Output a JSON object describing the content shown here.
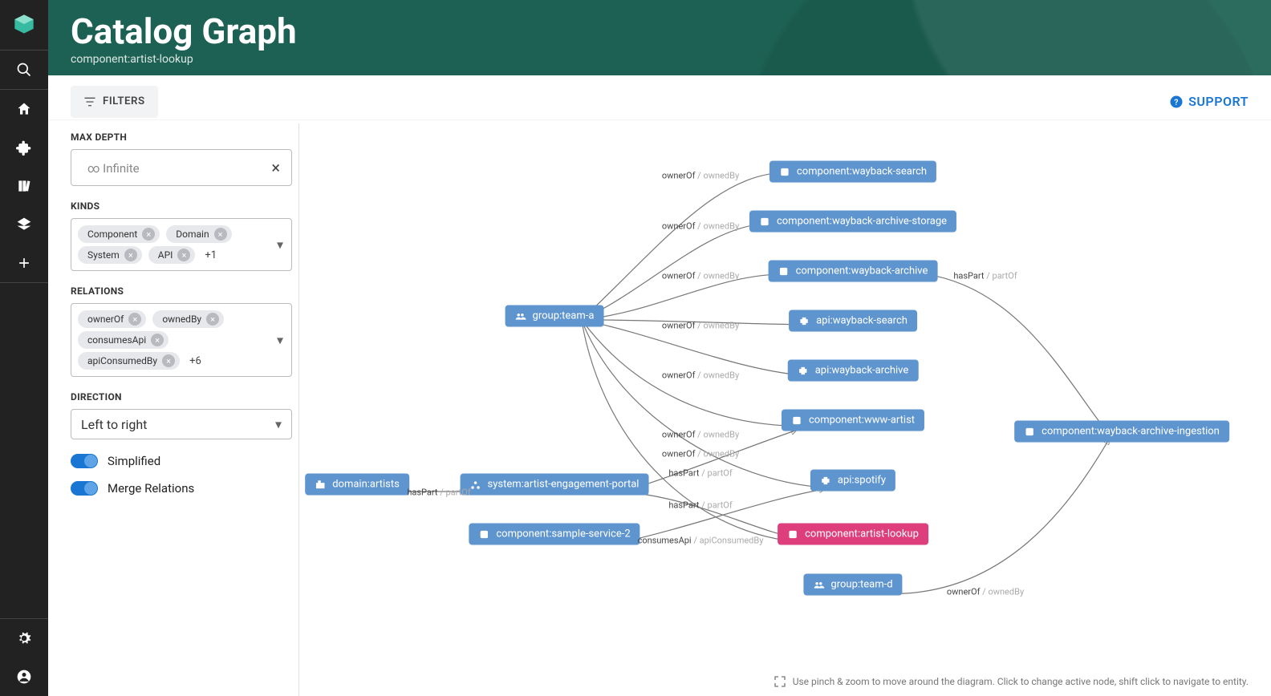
{
  "hero": {
    "title": "Catalog Graph",
    "subtitle": "component:artist-lookup"
  },
  "toolbar": {
    "filters_label": "FILTERS",
    "support_label": "SUPPORT"
  },
  "sidebar": {
    "maxdepth_label": "MAX DEPTH",
    "maxdepth_placeholder": "∞ Infinite",
    "kinds_label": "KINDS",
    "kinds_chips": [
      "Component",
      "Domain",
      "System",
      "API"
    ],
    "kinds_more": "+1",
    "relations_label": "RELATIONS",
    "relations_chips": [
      "ownerOf",
      "ownedBy",
      "consumesApi",
      "apiConsumedBy"
    ],
    "relations_more": "+6",
    "direction_label": "DIRECTION",
    "direction_value": "Left to right",
    "toggles": {
      "simplified_label": "Simplified",
      "merge_label": "Merge Relations"
    }
  },
  "graph": {
    "nodes": {
      "team_a": "group:team-a",
      "wayback_search_c": "component:wayback-search",
      "wayback_archive_storage_c": "component:wayback-archive-storage",
      "wayback_archive_c": "component:wayback-archive",
      "api_wayback_search": "api:wayback-search",
      "api_wayback_archive": "api:wayback-archive",
      "www_artist_c": "component:www-artist",
      "api_spotify": "api:spotify",
      "artist_lookup_c": "component:artist-lookup",
      "team_d": "group:team-d",
      "wayback_archive_ingestion_c": "component:wayback-archive-ingestion",
      "domain_artists": "domain:artists",
      "system_aep": "system:artist-engagement-portal",
      "sample_service_2": "component:sample-service-2"
    },
    "edge_labels": {
      "owner_owned": {
        "a": "ownerOf",
        "b": "ownedBy"
      },
      "has_part": {
        "a": "hasPart",
        "b": "partOf"
      },
      "consumes": {
        "a": "consumesApi",
        "b": "apiConsumedBy"
      }
    }
  },
  "hint": "Use pinch & zoom to move around the diagram. Click to change active node, shift click to navigate to entity."
}
